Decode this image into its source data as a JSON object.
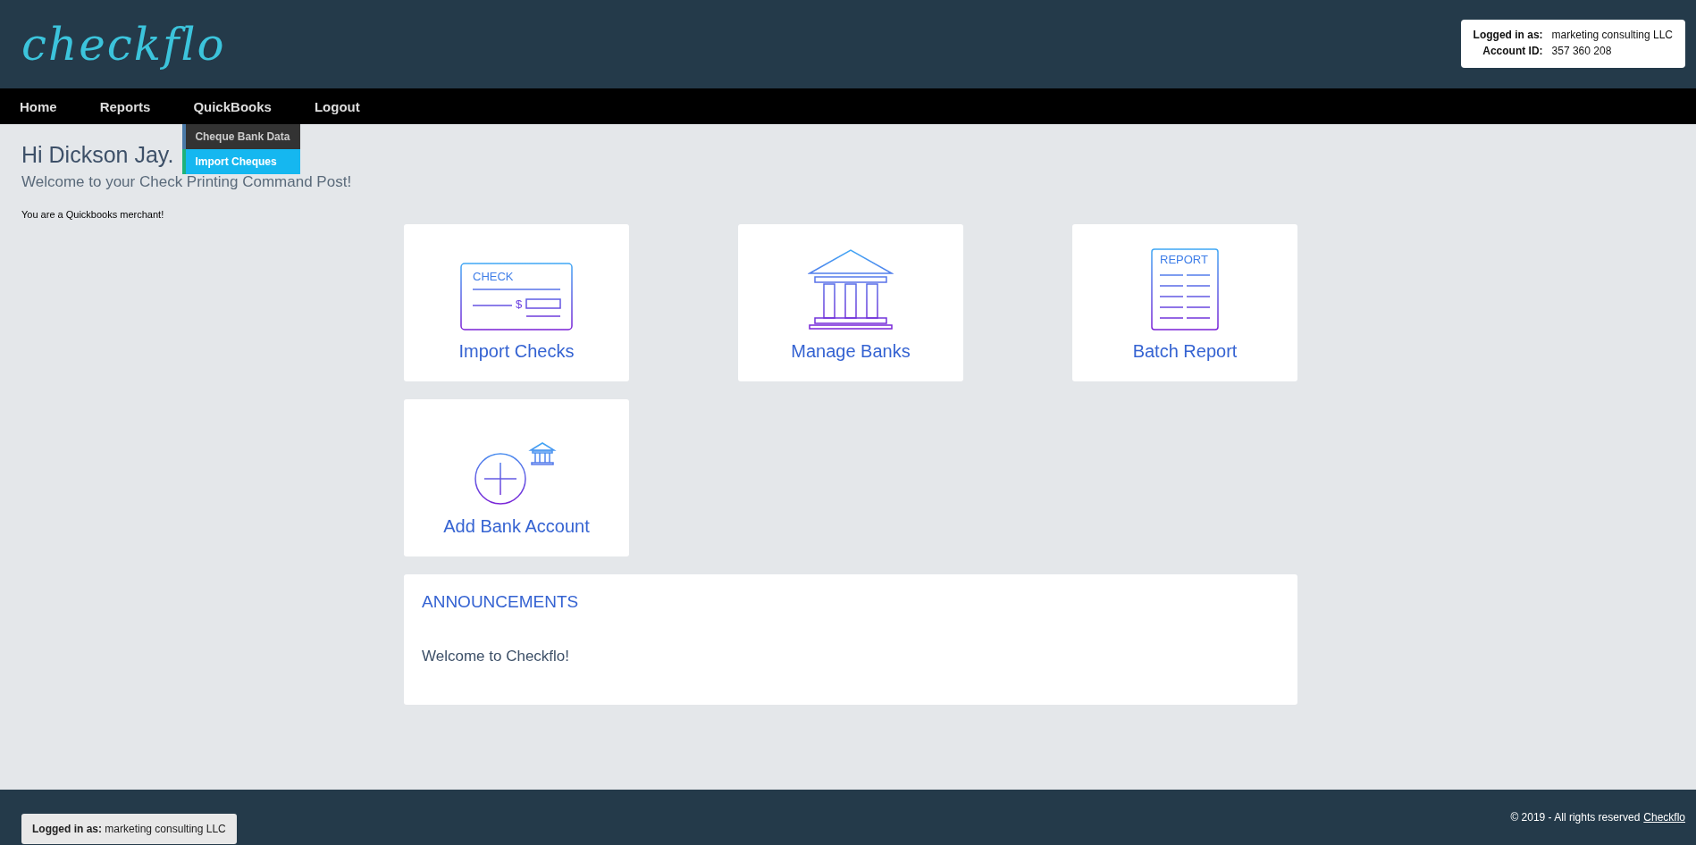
{
  "header": {
    "logo": "checkflo",
    "account": [
      {
        "label": "Logged in as:",
        "value": "marketing consulting LLC"
      },
      {
        "label": "Account ID:",
        "value": "357 360 208"
      }
    ]
  },
  "nav": {
    "items": [
      {
        "label": "Home"
      },
      {
        "label": "Reports"
      },
      {
        "label": "QuickBooks",
        "menu": [
          {
            "label": "Cheque Bank Data",
            "selected": false
          },
          {
            "label": "Import Cheques",
            "selected": true
          }
        ]
      },
      {
        "label": "Logout"
      }
    ]
  },
  "greeting": {
    "title": "Hi Dickson Jay.",
    "subtitle": "Welcome to your Check Printing Command Post!",
    "note": "You are a Quickbooks merchant!"
  },
  "cards": [
    {
      "kind": "check",
      "label": "Import Checks",
      "icon_text": "CHECK",
      "currency_sign": "$"
    },
    {
      "kind": "bank",
      "label": "Manage Banks"
    },
    {
      "kind": "report",
      "label": "Batch Report",
      "icon_text": "REPORT"
    },
    {
      "kind": "add-bank",
      "label": "Add Bank Account"
    }
  ],
  "announcements": {
    "title": "ANNOUNCEMENTS",
    "body": "Welcome to Checkflo!"
  },
  "footer": {
    "login_label": "Logged in as:",
    "login_value": "marketing consulting LLC",
    "copyright": "© 2019 - All rights reserved",
    "link": "Checkflo"
  }
}
